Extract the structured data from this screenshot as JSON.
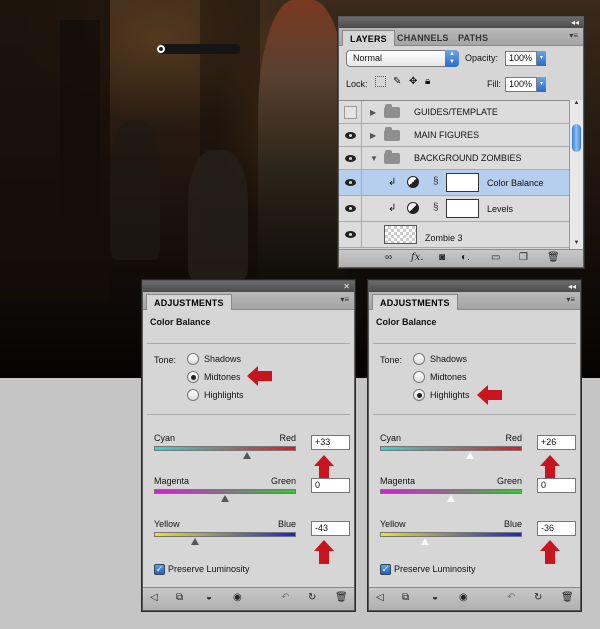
{
  "layers_panel": {
    "tabs": [
      "LAYERS",
      "CHANNELS",
      "PATHS"
    ],
    "blend_mode": "Normal",
    "opacity_label": "Opacity:",
    "opacity_value": "100%",
    "lock_label": "Lock:",
    "fill_label": "Fill:",
    "fill_value": "100%",
    "layers": [
      {
        "name": "GUIDES/TEMPLATE",
        "kind": "group",
        "visible": false
      },
      {
        "name": "MAIN FIGURES",
        "kind": "group",
        "visible": true
      },
      {
        "name": "BACKGROUND ZOMBIES",
        "kind": "group-open",
        "visible": true
      },
      {
        "name": "Color Balance",
        "kind": "adjustment",
        "visible": true,
        "selected": true
      },
      {
        "name": "Levels",
        "kind": "adjustment",
        "visible": true
      },
      {
        "name": "Zombie 3",
        "kind": "pixel",
        "visible": true
      }
    ],
    "footer_icons": [
      "link-icon",
      "fx-icon",
      "mask-icon",
      "adjustment-icon",
      "folder-icon",
      "new-layer-icon",
      "trash-icon"
    ]
  },
  "adjust_left": {
    "tab": "ADJUSTMENTS",
    "title": "Color Balance",
    "tone_label": "Tone:",
    "tones": [
      "Shadows",
      "Midtones",
      "Highlights"
    ],
    "selected_tone": "Midtones",
    "sliders": [
      {
        "left": "Cyan",
        "right": "Red",
        "value": "+33",
        "position": 0.665
      },
      {
        "left": "Magenta",
        "right": "Green",
        "value": "0",
        "position": 0.5
      },
      {
        "left": "Yellow",
        "right": "Blue",
        "value": "-43",
        "position": 0.285
      }
    ],
    "preserve_label": "Preserve Luminosity",
    "preserve_checked": true
  },
  "adjust_right": {
    "tab": "ADJUSTMENTS",
    "title": "Color Balance",
    "tone_label": "Tone:",
    "tones": [
      "Shadows",
      "Midtones",
      "Highlights"
    ],
    "selected_tone": "Highlights",
    "sliders": [
      {
        "left": "Cyan",
        "right": "Red",
        "value": "+26",
        "position": 0.63
      },
      {
        "left": "Magenta",
        "right": "Green",
        "value": "0",
        "position": 0.5
      },
      {
        "left": "Yellow",
        "right": "Blue",
        "value": "-36",
        "position": 0.32
      }
    ],
    "preserve_label": "Preserve Luminosity",
    "preserve_checked": true
  },
  "colors": {
    "arrow_red": "#c8141e",
    "selected_row": "#b6cfee",
    "cyan_red": [
      "#30d8d8",
      "#e01a1a"
    ],
    "magenta_green": [
      "#d020d0",
      "#40c040"
    ],
    "yellow_blue": [
      "#e8e820",
      "#2020d0"
    ]
  }
}
